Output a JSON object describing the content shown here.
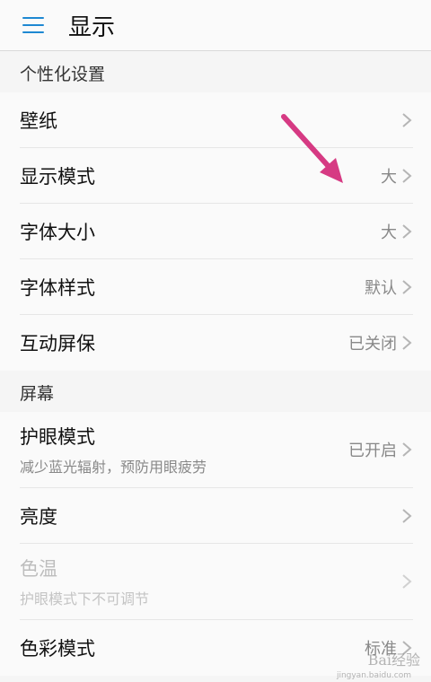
{
  "header": {
    "title": "显示",
    "menu_icon": "hamburger-menu-icon"
  },
  "accent_color": "#1e88d2",
  "sections": {
    "personalization": {
      "title": "个性化设置",
      "items": {
        "wallpaper": {
          "label": "壁纸",
          "value": ""
        },
        "display_mode": {
          "label": "显示模式",
          "value": "大"
        },
        "font_size": {
          "label": "字体大小",
          "value": "大"
        },
        "font_style": {
          "label": "字体样式",
          "value": "默认"
        },
        "screensaver": {
          "label": "互动屏保",
          "value": "已关闭"
        }
      }
    },
    "screen": {
      "title": "屏幕",
      "items": {
        "eye_comfort": {
          "label": "护眼模式",
          "subtitle": "减少蓝光辐射，预防用眼疲劳",
          "value": "已开启"
        },
        "brightness": {
          "label": "亮度",
          "value": ""
        },
        "color_temp": {
          "label": "色温",
          "subtitle": "护眼模式下不可调节",
          "value": ""
        },
        "color_mode": {
          "label": "色彩模式",
          "value": "标准"
        }
      }
    }
  },
  "annotation": {
    "arrow_color": "#d63a83",
    "icon": "pink-arrow-annotation"
  },
  "watermark": {
    "text": "Bai经验",
    "sub": "jingyan.baidu.com"
  }
}
